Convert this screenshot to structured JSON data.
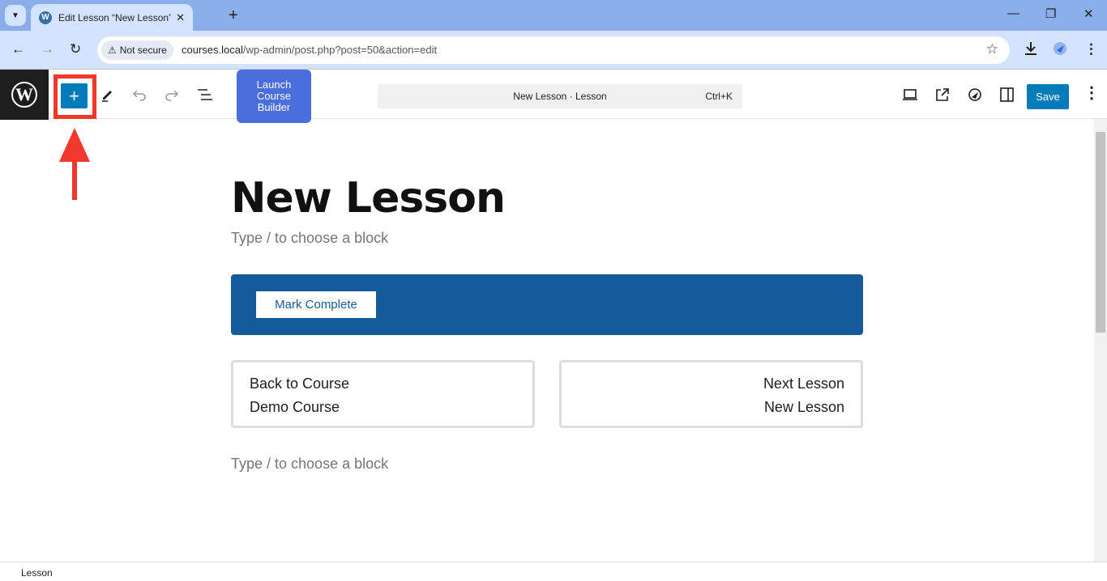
{
  "browser": {
    "tab_title": "Edit Lesson “New Lesson” ‹ cou",
    "security_label": "Not secure",
    "url_host": "courses.local",
    "url_path": "/wp-admin/post.php?post=50&action=edit"
  },
  "toolbar": {
    "launch_label": "Launch Course Builder",
    "command_title": "New Lesson · Lesson",
    "command_shortcut": "Ctrl+K",
    "save_label": "Save"
  },
  "editor": {
    "title": "New Lesson",
    "placeholder": "Type / to choose a block",
    "mark_complete": "Mark Complete",
    "back_card": {
      "line1": "Back to Course",
      "line2": "Demo Course"
    },
    "next_card": {
      "line1": "Next Lesson",
      "line2": "New Lesson"
    }
  },
  "status_bar": {
    "breadcrumb": "Lesson"
  },
  "colors": {
    "accent": "#007cba",
    "band": "#155a9a",
    "launch": "#4a6fdc",
    "annotation": "#f2372c"
  }
}
